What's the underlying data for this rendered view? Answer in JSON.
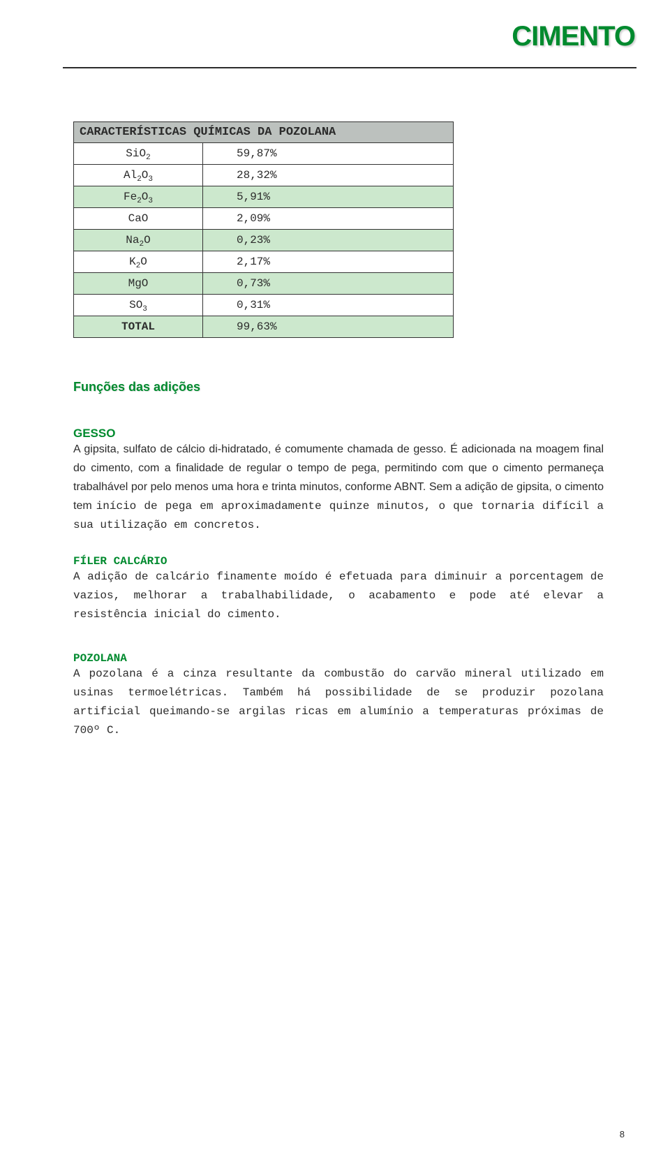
{
  "brand": "CIMENTO",
  "table": {
    "title": "CARACTERÍSTICAS QUÍMICAS DA POZOLANA",
    "rows": [
      {
        "label_base": "SiO",
        "label_sub": "2",
        "value": "59,87%",
        "highlight": false
      },
      {
        "label_base": "Al",
        "label_sub": "2",
        "label_tail": "O",
        "label_sub2": "3",
        "value": "28,32%",
        "highlight": false
      },
      {
        "label_base": "Fe",
        "label_sub": "2",
        "label_tail": "O",
        "label_sub2": "3",
        "value": "5,91%",
        "highlight": true
      },
      {
        "label_base": "CaO",
        "label_sub": "",
        "value": "2,09%",
        "highlight": false
      },
      {
        "label_base": "Na",
        "label_sub": "2",
        "label_tail": "O",
        "value": "0,23%",
        "highlight": true
      },
      {
        "label_base": "K",
        "label_sub": "2",
        "label_tail": "O",
        "value": "2,17%",
        "highlight": false
      },
      {
        "label_base": "MgO",
        "label_sub": "",
        "value": "0,73%",
        "highlight": true
      },
      {
        "label_base": "SO",
        "label_sub": "3",
        "value": "0,31%",
        "highlight": false
      }
    ],
    "total_label": "TOTAL",
    "total_value": "99,63%"
  },
  "sections": {
    "funcoes_heading": "Funções das adições",
    "gesso": {
      "heading": "GESSO",
      "text_arial": "A gipsita, sulfato de cálcio di-hidratado, é comumente chamada de gesso. É adicionada na moagem final do cimento,  com a finalidade de regular o tempo de pega, permitindo com que o cimento permaneça trabalhável por pelo menos uma hora e trinta minutos, conforme ABNT. Sem a adição de  gipsita, o cimento tem ",
      "text_mono": "início de pega em aproximadamente quinze minutos, o que tornaria difícil a sua utilização em concretos."
    },
    "filer": {
      "heading": "FÍLER  CALCÁRIO",
      "text": "A adição de calcário finamente moído é efetuada para diminuir a porcentagem de vazios, melhorar a trabalhabilidade, o acabamento e pode até elevar a resistência inicial do cimento."
    },
    "pozolana": {
      "heading": "POZOLANA",
      "text": "A pozolana é a cinza resultante da combustão do carvão mineral utilizado em usinas termoelétricas. Também há possibilidade de se produzir pozolana artificial queimando-se argilas ricas em alumínio a temperaturas próximas de 700º C."
    }
  },
  "page_number": "8"
}
